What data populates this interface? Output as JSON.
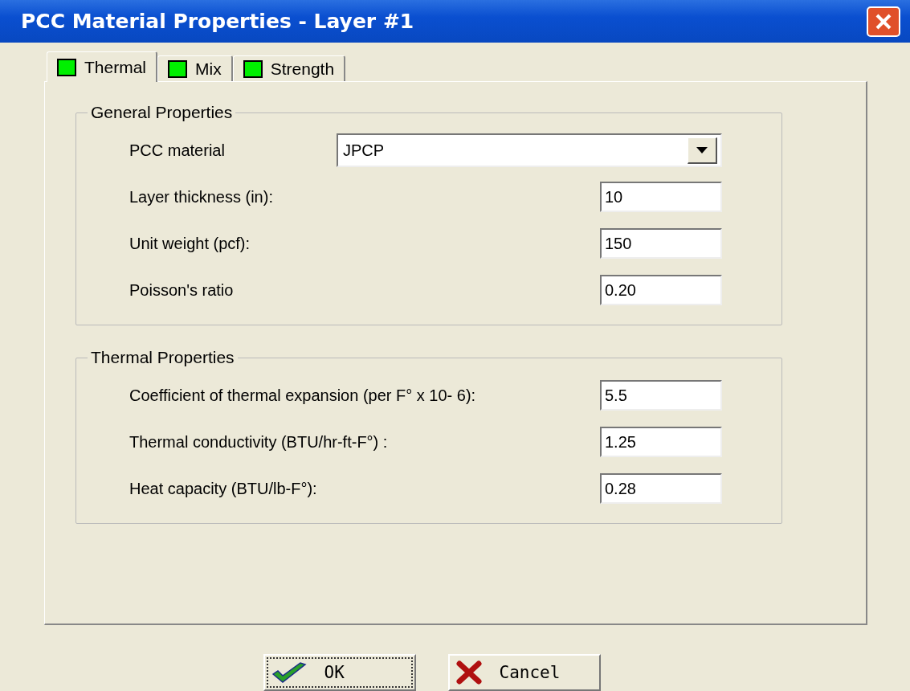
{
  "window": {
    "title": "PCC Material Properties - Layer #1"
  },
  "tabs": [
    {
      "label": "Thermal",
      "selected": true
    },
    {
      "label": "Mix",
      "selected": false
    },
    {
      "label": "Strength",
      "selected": false
    }
  ],
  "groups": [
    {
      "title": "General Properties",
      "fields": [
        {
          "kind": "dropdown",
          "label": "PCC material",
          "value": "JPCP"
        },
        {
          "kind": "text",
          "label": "Layer thickness (in):",
          "value": "10"
        },
        {
          "kind": "text",
          "label": "Unit weight (pcf):",
          "value": "150"
        },
        {
          "kind": "text",
          "label": "Poisson's ratio",
          "value": "0.20"
        }
      ]
    },
    {
      "title": "Thermal Properties",
      "fields": [
        {
          "kind": "text",
          "label": "Coefficient of thermal expansion (per F° x 10- 6):",
          "value": "5.5"
        },
        {
          "kind": "text",
          "label": "Thermal conductivity (BTU/hr-ft-F°) :",
          "value": "1.25"
        },
        {
          "kind": "text",
          "label": "Heat capacity (BTU/lb-F°):",
          "value": "0.28"
        }
      ]
    }
  ],
  "buttons": [
    {
      "kind": "ok",
      "label": "OK",
      "focused": true
    },
    {
      "kind": "cancel",
      "label": "Cancel",
      "focused": false
    }
  ]
}
